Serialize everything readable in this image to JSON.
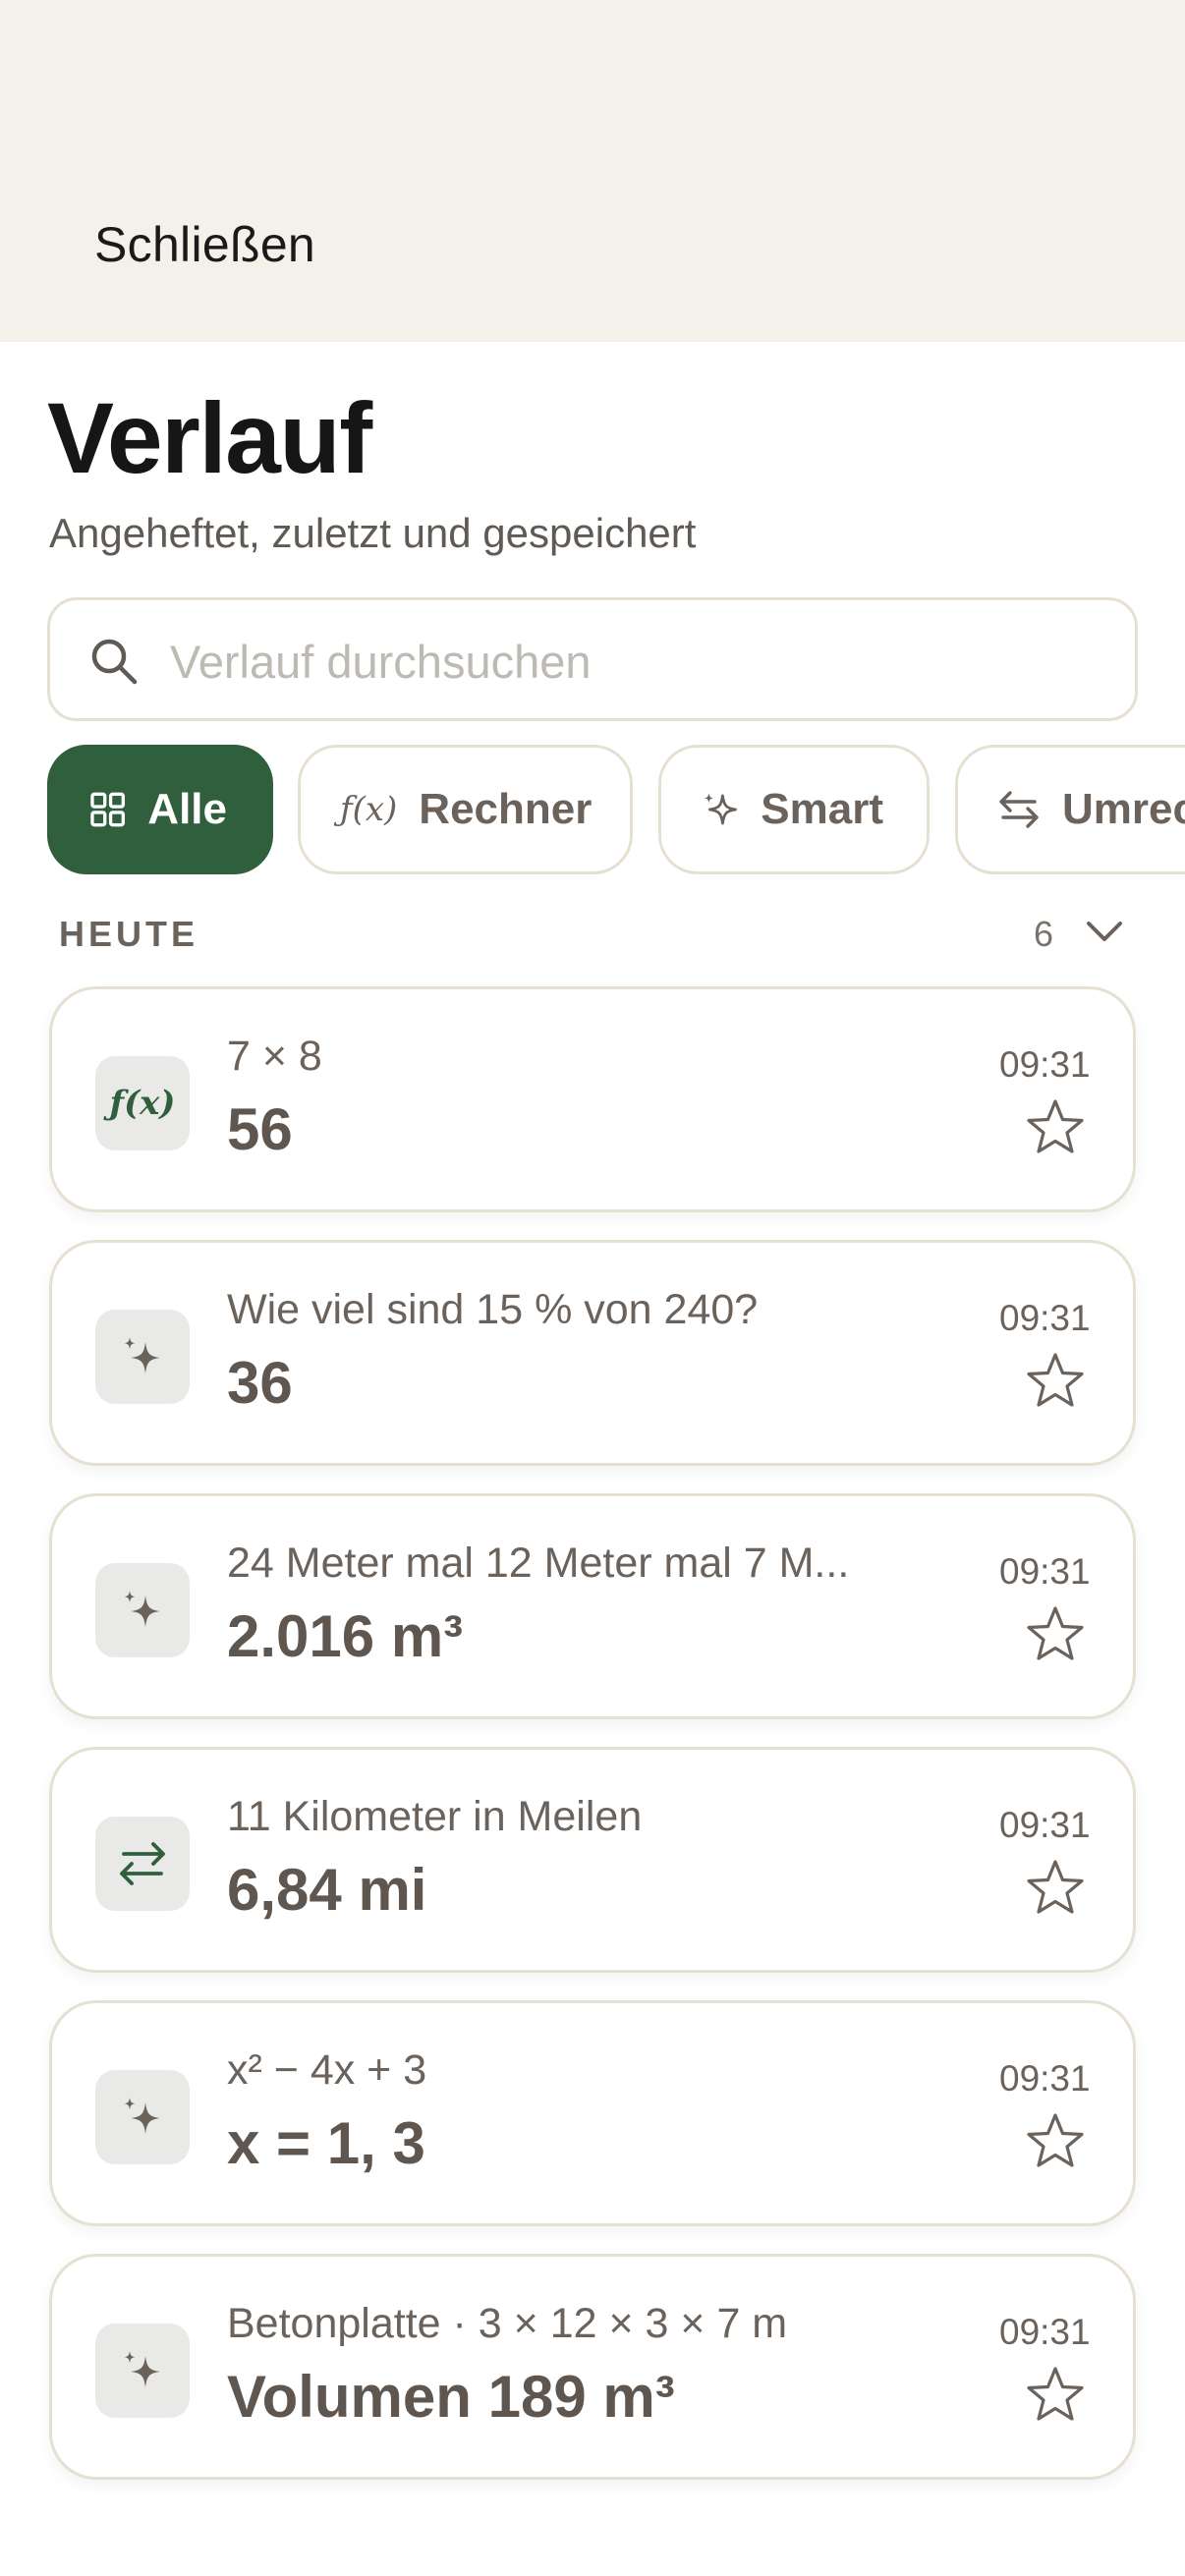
{
  "header": {
    "close_label": "Schließen",
    "title": "Verlauf",
    "subtitle": "Angeheftet, zuletzt und gespeichert"
  },
  "search": {
    "placeholder": "Verlauf durchsuchen",
    "value": ""
  },
  "filters": [
    {
      "label": "Alle",
      "icon": "grid-icon",
      "active": true
    },
    {
      "label": "Rechner",
      "icon": "function-icon",
      "active": false
    },
    {
      "label": "Smart",
      "icon": "sparkle-icon",
      "active": false
    },
    {
      "label": "Umrec",
      "icon": "swap-arrows-icon",
      "active": false
    }
  ],
  "section": {
    "label": "HEUTE",
    "count": "6"
  },
  "entries": [
    {
      "type": "calculator",
      "icon": "function-icon",
      "icon_text": "ƒ(x)",
      "expression": "7 × 8",
      "result": "56",
      "time": "09:31"
    },
    {
      "type": "smart",
      "icon": "sparkle-icon",
      "expression": "Wie viel sind 15 % von 240?",
      "result": "36",
      "time": "09:31"
    },
    {
      "type": "smart",
      "icon": "sparkle-icon",
      "expression": "24 Meter mal 12 Meter mal 7 M...",
      "result": "2.016 m³",
      "time": "09:31"
    },
    {
      "type": "convert",
      "icon": "swap-arrows-icon",
      "expression": "11 Kilometer in Meilen",
      "result": "6,84 mi",
      "time": "09:31"
    },
    {
      "type": "smart",
      "icon": "sparkle-icon",
      "expression": "x² − 4x + 3",
      "result": "x = 1, 3",
      "time": "09:31"
    },
    {
      "type": "smart",
      "icon": "sparkle-icon",
      "expression": "Betonplatte · 3 × 12 × 3 × 7 m",
      "result": "Volumen 189 m³",
      "time": "09:31"
    }
  ],
  "colors": {
    "accent": "#2f5f3c",
    "header_bg": "#f4f0ea",
    "border": "#e6e0d2",
    "muted_text": "#6b635b",
    "icon_bg": "#e9eae7"
  }
}
